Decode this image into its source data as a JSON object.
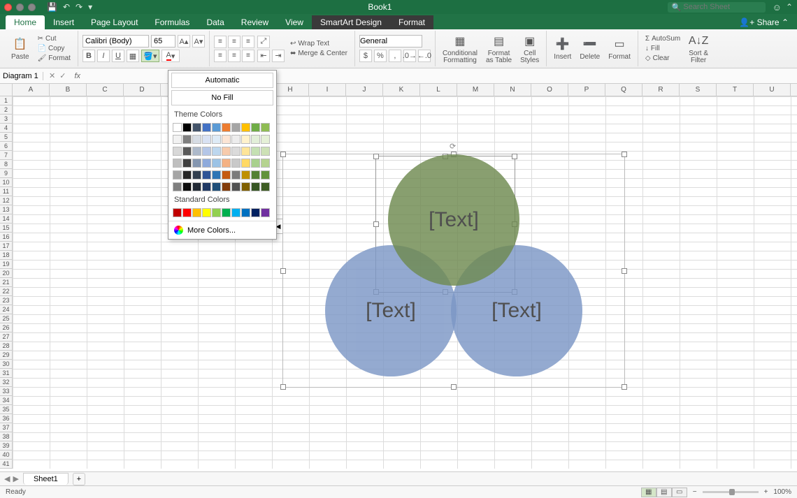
{
  "title": "Book1",
  "search_placeholder": "Search Sheet",
  "tabs": [
    "Home",
    "Insert",
    "Page Layout",
    "Formulas",
    "Data",
    "Review",
    "View",
    "SmartArt Design",
    "Format"
  ],
  "active_tab": 0,
  "share_label": "Share",
  "ribbon": {
    "paste": "Paste",
    "cut": "Cut",
    "copy": "Copy",
    "format_painter": "Format",
    "font_name": "Calibri (Body)",
    "font_size": "65",
    "wrap_text": "Wrap Text",
    "merge_center": "Merge & Center",
    "number_format": "General",
    "cond_fmt": "Conditional\nFormatting",
    "fmt_table": "Format\nas Table",
    "cell_styles": "Cell\nStyles",
    "insert": "Insert",
    "delete": "Delete",
    "format": "Format",
    "autosum": "AutoSum",
    "fill": "Fill",
    "clear": "Clear",
    "sort_filter": "Sort &\nFilter"
  },
  "namebox": "Diagram 1",
  "fx": "fx",
  "columns": [
    "A",
    "B",
    "C",
    "D",
    "",
    "",
    "",
    "H",
    "I",
    "J",
    "K",
    "L",
    "M",
    "N",
    "O",
    "P",
    "Q",
    "R",
    "S",
    "T",
    "U"
  ],
  "row_count": 41,
  "colorpicker": {
    "automatic": "Automatic",
    "nofill": "No Fill",
    "theme_label": "Theme Colors",
    "standard_label": "Standard Colors",
    "more_colors": "More Colors...",
    "theme_row1": [
      "#ffffff",
      "#000000",
      "#44546a",
      "#4472c4",
      "#5b9bd5",
      "#ed7d31",
      "#a5a5a5",
      "#ffc000",
      "#70ad47",
      "#8fbc54"
    ],
    "theme_shades": [
      [
        "#f2f2f2",
        "#7f7f7f",
        "#d6dce4",
        "#d9e2f3",
        "#deebf6",
        "#fce5d5",
        "#ededed",
        "#fff2cc",
        "#e2efd9",
        "#e5f0d7"
      ],
      [
        "#d8d8d8",
        "#595959",
        "#adb9ca",
        "#b4c6e7",
        "#bdd7ee",
        "#f7cbac",
        "#dbdbdb",
        "#fee599",
        "#c5e0b3",
        "#cde1b6"
      ],
      [
        "#bfbfbf",
        "#3f3f3f",
        "#8496b0",
        "#8eaadb",
        "#9cc3e5",
        "#f4b183",
        "#c9c9c9",
        "#ffd965",
        "#a8d08d",
        "#b5d38f"
      ],
      [
        "#a5a5a5",
        "#262626",
        "#323f4f",
        "#2f5496",
        "#2e75b5",
        "#c55a11",
        "#7b7b7b",
        "#bf9000",
        "#538135",
        "#62933b"
      ],
      [
        "#7f7f7f",
        "#0c0c0c",
        "#222a35",
        "#1f3864",
        "#1e4e79",
        "#833c0b",
        "#525252",
        "#7f6000",
        "#375623",
        "#3e5d24"
      ]
    ],
    "standard": [
      "#c00000",
      "#ff0000",
      "#ffc000",
      "#ffff00",
      "#92d050",
      "#00b050",
      "#00b0f0",
      "#0070c0",
      "#002060",
      "#7030a0"
    ]
  },
  "venn": {
    "top": "[Text]",
    "left": "[Text]",
    "right": "[Text]"
  },
  "sheet_tab": "Sheet1",
  "status": "Ready",
  "zoom": "100%"
}
